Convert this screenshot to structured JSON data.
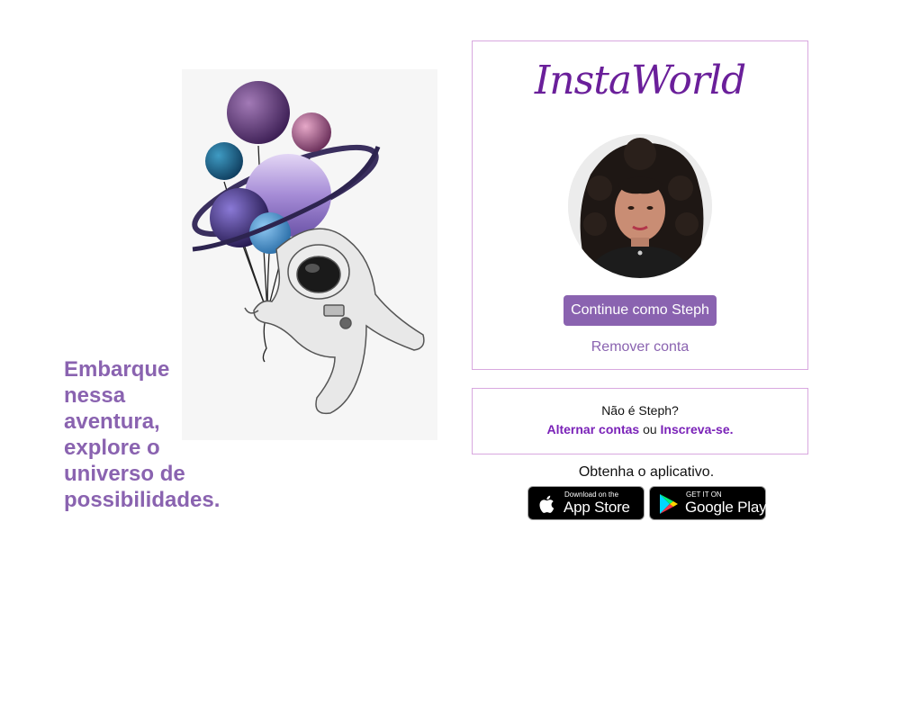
{
  "tagline": {
    "line1": "Embarque",
    "line2": "nessa",
    "line3": "aventura,",
    "line4": "explore o",
    "line5": "universo de",
    "line6": "possibilidades."
  },
  "brand": {
    "logo_text": "InstaWorld",
    "accent_color": "#8a63b0",
    "logo_color": "#6a1f9a",
    "link_color": "#7a22b8",
    "border_color": "#d8a8df"
  },
  "login": {
    "continue_label": "Continue como Steph",
    "remove_label": "Remover conta"
  },
  "switch": {
    "question": "Não é Steph?",
    "switch_label": "Alternar contas",
    "or_label": "ou",
    "signup_label": "Inscreva-se."
  },
  "app": {
    "get_app_label": "Obtenha o aplicativo.",
    "appstore": {
      "small": "Download on the",
      "big": "App Store"
    },
    "googleplay": {
      "small": "GET IT ON",
      "big": "Google Play"
    }
  },
  "icons": {
    "apple": "apple-icon",
    "google_play": "google-play-icon"
  }
}
